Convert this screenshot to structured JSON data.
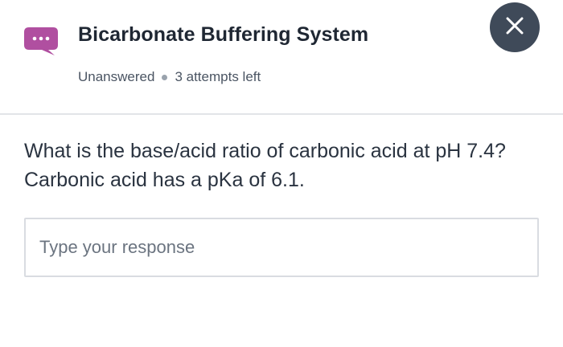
{
  "header": {
    "title": "Bicarbonate Buffering System",
    "status": "Unanswered",
    "attempts": "3 attempts left",
    "icon": "chat-bubble-ellipsis-icon",
    "icon_color": "#b04fa0",
    "close_icon": "close-icon",
    "close_button_color": "#3f4a59"
  },
  "question": {
    "text": "What is the base/acid ratio of carbonic acid at pH 7.4? Carbonic acid has a pKa of 6.1."
  },
  "response": {
    "value": "",
    "placeholder": "Type your response"
  }
}
